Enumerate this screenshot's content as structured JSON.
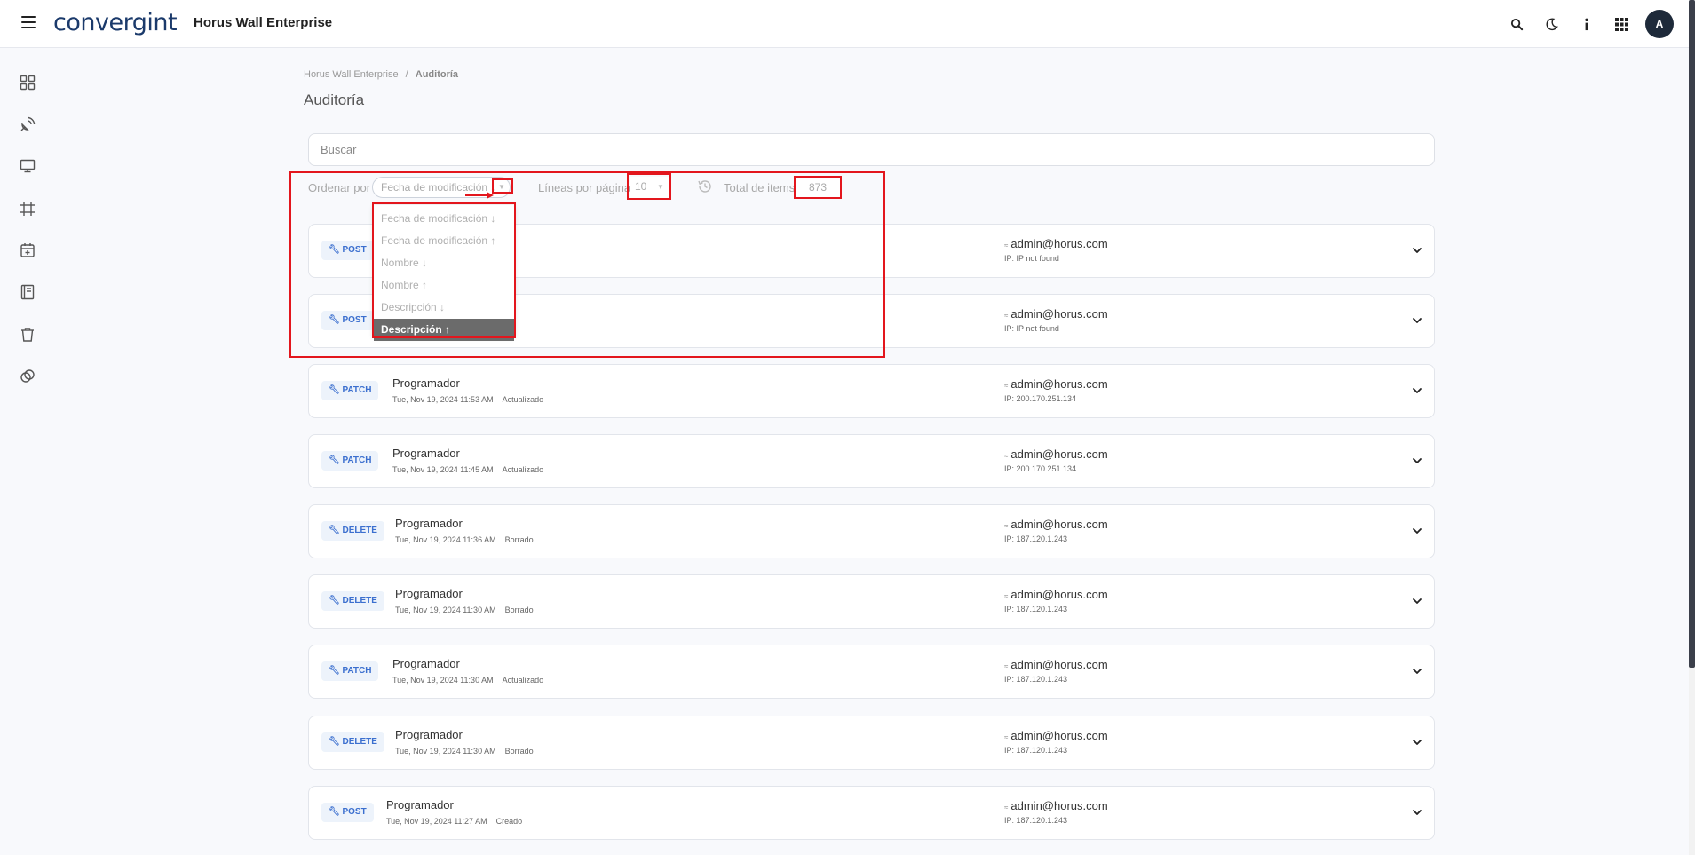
{
  "header": {
    "logo_text": "convergint",
    "app_title": "Horus Wall Enterprise",
    "avatar_initial": "A",
    "icons": [
      "menu-icon",
      "search-icon",
      "moon-icon",
      "info-icon",
      "apps-grid-icon"
    ]
  },
  "sidebar": {
    "icons": [
      "dashboard-icon",
      "satellite-icon",
      "monitor-icon",
      "grid-frame-icon",
      "calendar-plus-icon",
      "book-icon",
      "trash-icon",
      "layers-icon"
    ]
  },
  "breadcrumb": {
    "root": "Horus Wall Enterprise",
    "separator": "/",
    "current": "Auditoría"
  },
  "page_title": "Auditoría",
  "search": {
    "placeholder": "Buscar"
  },
  "toolbar": {
    "sort_label": "Ordenar por",
    "sort_value": "Fecha de modificación ↓",
    "lines_label": "Líneas por página",
    "lines_value": "10",
    "total_label": "Total de items",
    "total_value": "873"
  },
  "sort_options": [
    "Fecha de modificación ↓",
    "Fecha de modificación ↑",
    "Nombre ↓",
    "Nombre ↑",
    "Descripción ↓",
    "Descripción ↑"
  ],
  "sort_selected_index": 5,
  "records": [
    {
      "method": "POST",
      "title": "",
      "date": "",
      "action": "",
      "user": "admin@horus.com",
      "ip": "IP: IP not found"
    },
    {
      "method": "POST",
      "title": "",
      "date": "",
      "action": "",
      "user": "admin@horus.com",
      "ip": "IP: IP not found"
    },
    {
      "method": "PATCH",
      "title": "Programador",
      "date": "Tue, Nov 19, 2024 11:53 AM",
      "action": "Actualizado",
      "user": "admin@horus.com",
      "ip": "IP: 200.170.251.134"
    },
    {
      "method": "PATCH",
      "title": "Programador",
      "date": "Tue, Nov 19, 2024 11:45 AM",
      "action": "Actualizado",
      "user": "admin@horus.com",
      "ip": "IP: 200.170.251.134"
    },
    {
      "method": "DELETE",
      "title": "Programador",
      "date": "Tue, Nov 19, 2024 11:36 AM",
      "action": "Borrado",
      "user": "admin@horus.com",
      "ip": "IP: 187.120.1.243"
    },
    {
      "method": "DELETE",
      "title": "Programador",
      "date": "Tue, Nov 19, 2024 11:30 AM",
      "action": "Borrado",
      "user": "admin@horus.com",
      "ip": "IP: 187.120.1.243"
    },
    {
      "method": "PATCH",
      "title": "Programador",
      "date": "Tue, Nov 19, 2024 11:30 AM",
      "action": "Actualizado",
      "user": "admin@horus.com",
      "ip": "IP: 187.120.1.243"
    },
    {
      "method": "DELETE",
      "title": "Programador",
      "date": "Tue, Nov 19, 2024 11:30 AM",
      "action": "Borrado",
      "user": "admin@horus.com",
      "ip": "IP: 187.120.1.243"
    },
    {
      "method": "POST",
      "title": "Programador",
      "date": "Tue, Nov 19, 2024 11:27 AM",
      "action": "Creado",
      "user": "admin@horus.com",
      "ip": "IP: 187.120.1.243"
    }
  ],
  "colors": {
    "annotation": "#e3161d",
    "method_text": "#3b6fcf",
    "method_bg": "#edf3fb",
    "selected_option_bg": "#6b6b6b"
  }
}
